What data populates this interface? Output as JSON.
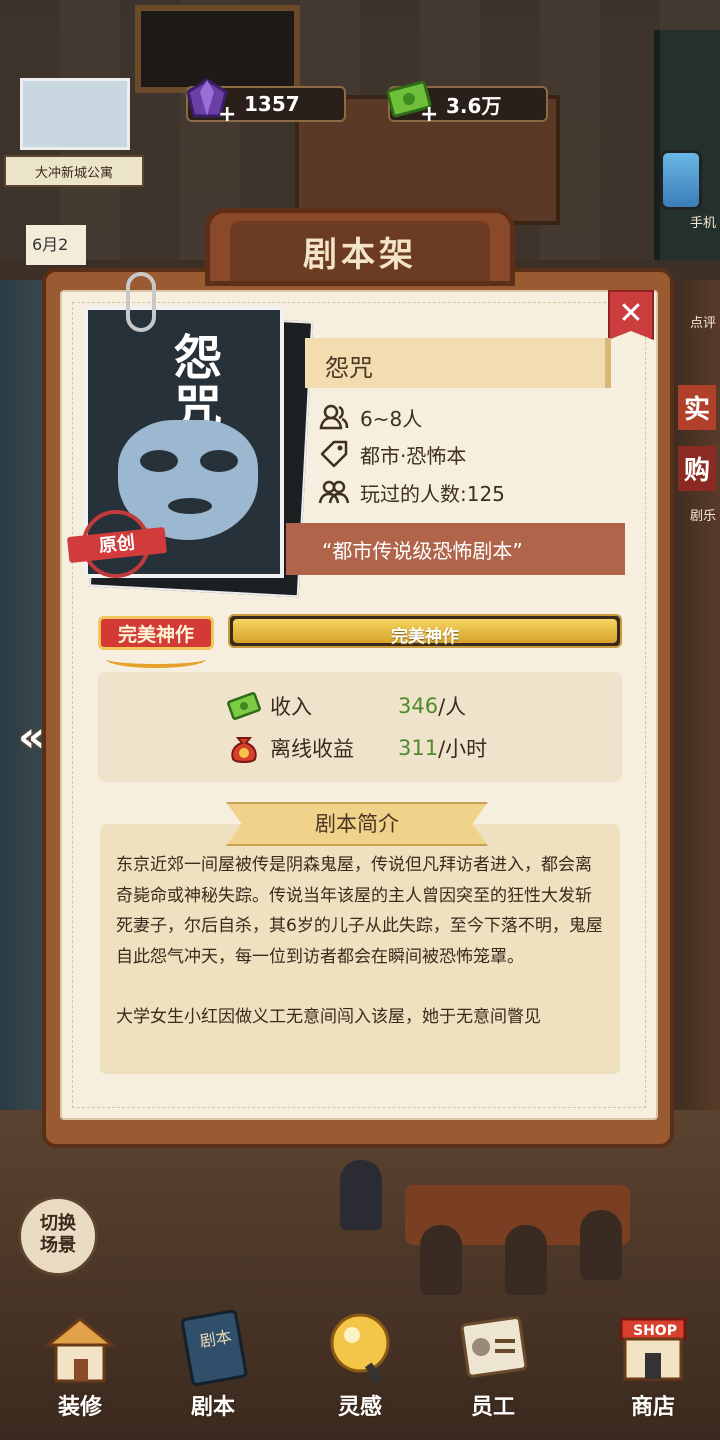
{
  "hud": {
    "gems": "1357",
    "cash": "3.6万",
    "location": "大冲新城公寓",
    "date": "6月2",
    "phone_label": "手机",
    "review_label": "点评",
    "real_label": "实",
    "buy_label": "购",
    "fun_label": "剧乐"
  },
  "dialog": {
    "header": "剧本架",
    "close": "✕",
    "back": "«"
  },
  "script": {
    "cover_title": "怨咒",
    "stamp": "原创",
    "name": "怨咒",
    "players": "6~8人",
    "genre": "都市·恐怖本",
    "played": "玩过的人数:125",
    "tagline": "“都市传说级恐怖剧本”"
  },
  "rating": {
    "badge": "完美神作",
    "bar_label": "完美神作",
    "fill_fraction": 1.0
  },
  "income": {
    "income_label": "收入",
    "income_value": "346",
    "income_unit": "/人",
    "offline_label": "离线收益",
    "offline_value": "311",
    "offline_unit": "/小时"
  },
  "summary": {
    "title": "剧本简介",
    "paragraph1": "东京近郊一间屋被传是阴森鬼屋，传说但凡拜访者进入，都会离奇毙命或神秘失踪。传说当年该屋的主人曾因突至的狂性大发斩死妻子，尔后自杀，其6岁的儿子从此失踪，至今下落不明，鬼屋自此怨气冲天，每一位到访者都会在瞬间被恐怖笼罩。",
    "paragraph2": "大学女生小红因做义工无意间闯入该屋，她于无意间瞥见"
  },
  "nav": {
    "switch_scene": "切换\n场景",
    "items": [
      {
        "label": "装修",
        "icon": "house-icon"
      },
      {
        "label": "剧本",
        "icon": "book-icon"
      },
      {
        "label": "灵感",
        "icon": "bulb-icon"
      },
      {
        "label": "员工",
        "icon": "badge-icon"
      },
      {
        "label": "商店",
        "icon": "shop-icon"
      }
    ]
  },
  "colors": {
    "accent_red": "#cc3d3d",
    "paper": "#f6efdf",
    "income_green": "#4f8a2c",
    "quote_bar": "#b0654a",
    "rating_gold": "#d5a22a"
  }
}
